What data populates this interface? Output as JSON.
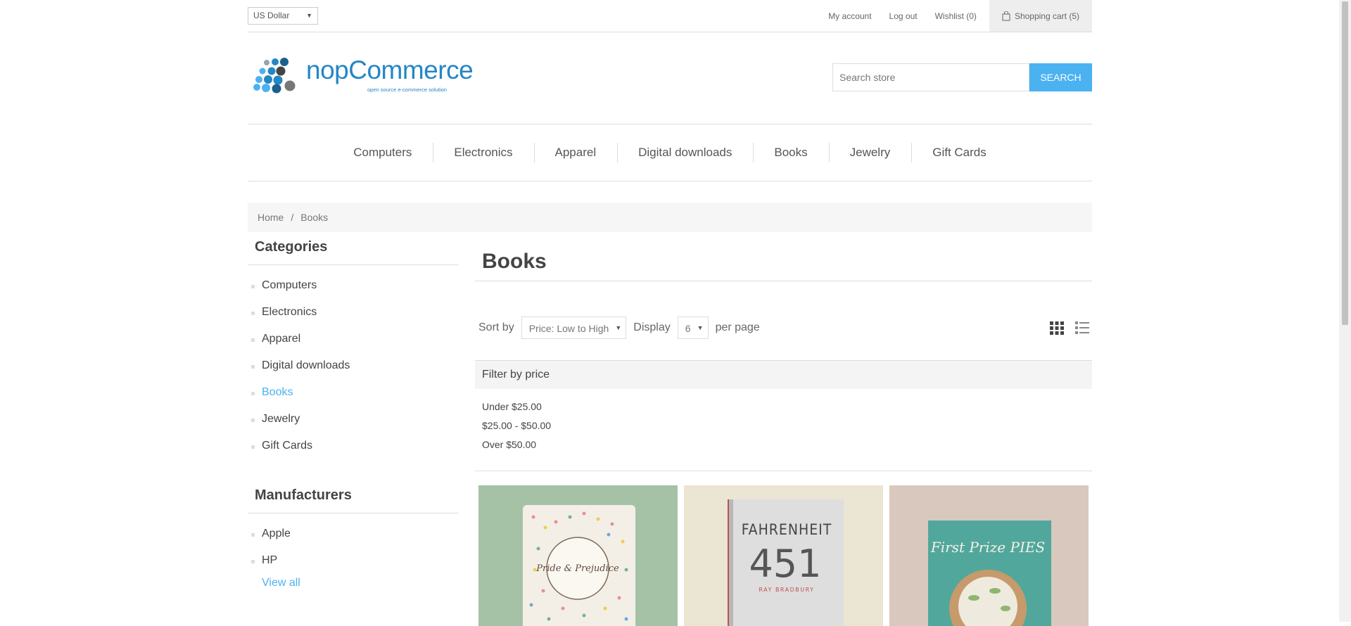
{
  "header": {
    "currency": "US Dollar",
    "links": {
      "my_account": "My account",
      "logout": "Log out",
      "wishlist": "Wishlist (0)",
      "cart": "Shopping cart (5)"
    },
    "logo": {
      "brand": "nopCommerce",
      "tagline": "open source e-commerce solution"
    },
    "search": {
      "placeholder": "Search store",
      "button": "SEARCH"
    }
  },
  "menu": [
    "Computers",
    "Electronics",
    "Apparel",
    "Digital downloads",
    "Books",
    "Jewelry",
    "Gift Cards"
  ],
  "breadcrumb": {
    "home": "Home",
    "separator": "/",
    "current": "Books"
  },
  "sidebar": {
    "categories_title": "Categories",
    "categories": [
      "Computers",
      "Electronics",
      "Apparel",
      "Digital downloads",
      "Books",
      "Jewelry",
      "Gift Cards"
    ],
    "active_category": "Books",
    "manufacturers_title": "Manufacturers",
    "manufacturers": [
      "Apple",
      "HP"
    ],
    "view_all": "View all"
  },
  "main": {
    "title": "Books",
    "sort_label": "Sort by",
    "sort_value": "Price: Low to High",
    "display_label": "Display",
    "display_value": "6",
    "per_page": "per page",
    "filter_title": "Filter by price",
    "price_ranges": [
      "Under $25.00",
      "$25.00 - $50.00",
      "Over $50.00"
    ],
    "products": [
      {
        "cover_title": "Pride & Prejudice",
        "bg": "#a5c2a6"
      },
      {
        "cover_title": "FAHRENHEIT",
        "cover_number": "451",
        "cover_author": "RAY BRADBURY",
        "bg": "#ebe5d3"
      },
      {
        "cover_title": "First Prize PIES",
        "bg": "#d9c8bd"
      }
    ]
  },
  "colors": {
    "accent": "#4ab2f1",
    "brand": "#2586c4"
  }
}
